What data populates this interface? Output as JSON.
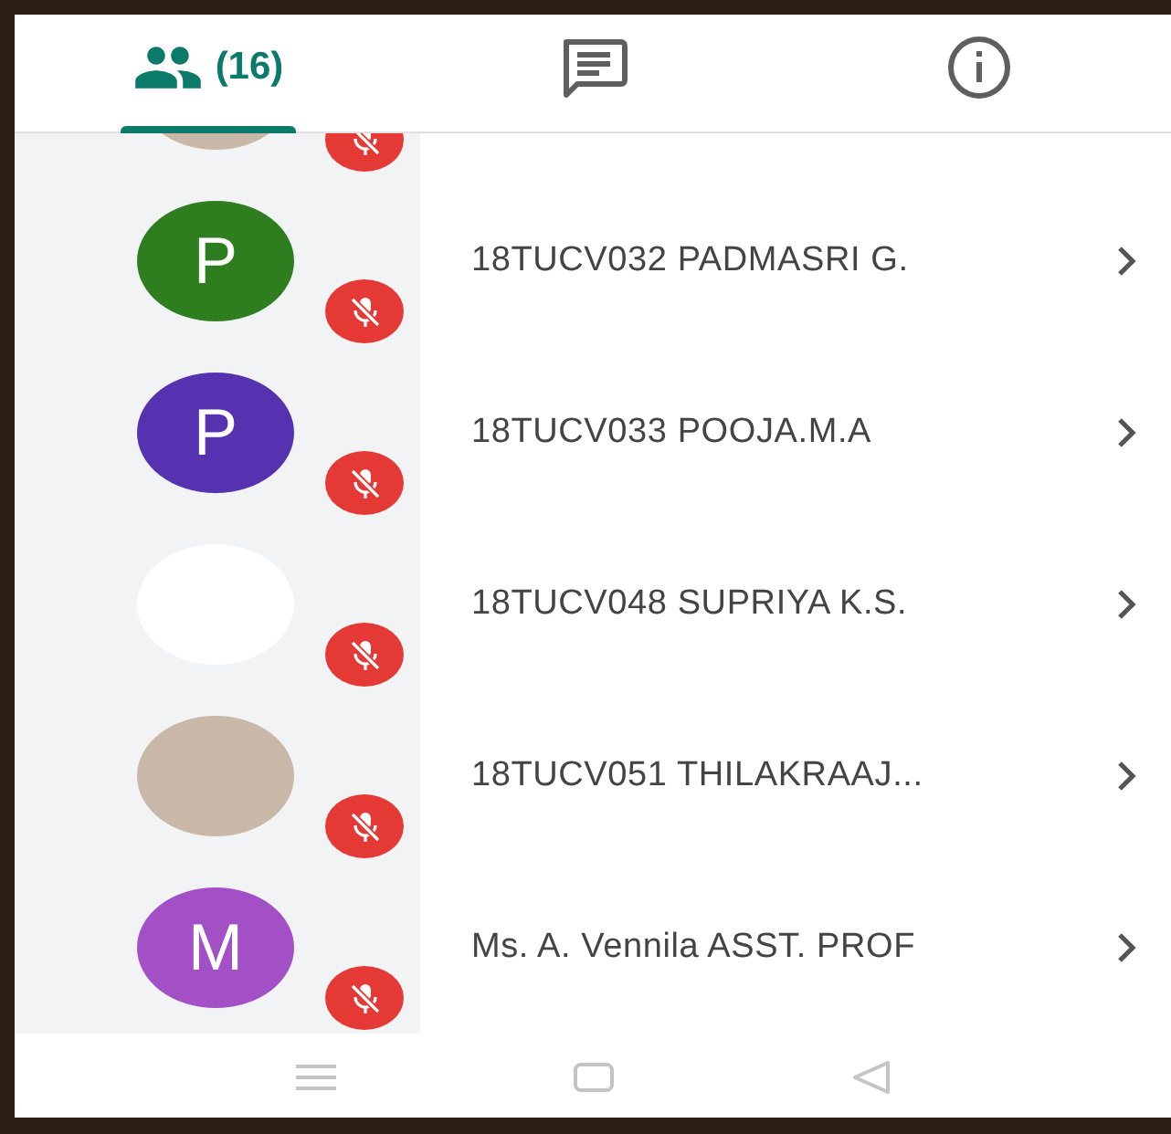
{
  "tabs": [
    {
      "kind": "people",
      "label": "(16)",
      "selected": true
    },
    {
      "kind": "chat",
      "selected": false
    },
    {
      "kind": "info",
      "selected": false
    }
  ],
  "participants": [
    {
      "kind": "photo",
      "muted": true
    },
    {
      "kind": "letter",
      "letter": "P",
      "color": "#2e7d1e",
      "name": "18TUCV032 PADMASRI G.",
      "muted": true
    },
    {
      "kind": "letter",
      "letter": "P",
      "color": "#5631b0",
      "name": "18TUCV033 POOJA.M.A",
      "muted": true
    },
    {
      "kind": "blank",
      "name": "18TUCV048 SUPRIYA K.S.",
      "muted": true
    },
    {
      "kind": "photo",
      "name": "18TUCV051 THILAKRAAJ...",
      "muted": true
    },
    {
      "kind": "letter",
      "letter": "M",
      "color": "#a34fc6",
      "name": "Ms. A. Vennila ASST. PROF",
      "muted": true
    }
  ],
  "nav_bar": [
    {
      "kind": "menu"
    },
    {
      "kind": "home"
    },
    {
      "kind": "back"
    }
  ]
}
